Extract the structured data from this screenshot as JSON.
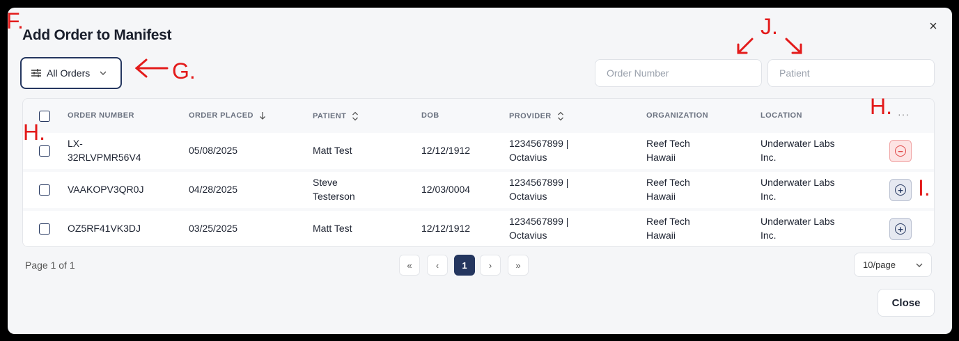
{
  "modal": {
    "title": "Add Order to Manifest",
    "close_icon": "×"
  },
  "filter": {
    "label": "All Orders"
  },
  "search": {
    "order_placeholder": "Order Number",
    "patient_placeholder": "Patient"
  },
  "table": {
    "headers": {
      "order_number": "ORDER NUMBER",
      "order_placed": "ORDER PLACED",
      "patient": "PATIENT",
      "dob": "DOB",
      "provider": "PROVIDER",
      "organization": "ORGANIZATION",
      "location": "LOCATION",
      "more": "···"
    },
    "rows": [
      {
        "order_number_1": "LX-",
        "order_number_2": "32RLVPMR56V4",
        "order_placed": "05/08/2025",
        "patient_1": "Matt Test",
        "patient_2": "",
        "dob": "12/12/1912",
        "provider_1": "1234567899 |",
        "provider_2": "Octavius",
        "organization_1": "Reef Tech",
        "organization_2": "Hawaii",
        "location_1": "Underwater Labs",
        "location_2": "Inc.",
        "action_icon": "−"
      },
      {
        "order_number_1": "VAAKOPV3QR0J",
        "order_number_2": "",
        "order_placed": "04/28/2025",
        "patient_1": "Steve",
        "patient_2": "Testerson",
        "dob": "12/03/0004",
        "provider_1": "1234567899 |",
        "provider_2": "Octavius",
        "organization_1": "Reef Tech",
        "organization_2": "Hawaii",
        "location_1": "Underwater Labs",
        "location_2": "Inc.",
        "action_icon": "+"
      },
      {
        "order_number_1": "OZ5RF41VK3DJ",
        "order_number_2": "",
        "order_placed": "03/25/2025",
        "patient_1": "Matt Test",
        "patient_2": "",
        "dob": "12/12/1912",
        "provider_1": "1234567899 |",
        "provider_2": "Octavius",
        "organization_1": "Reef Tech",
        "organization_2": "Hawaii",
        "location_1": "Underwater Labs",
        "location_2": "Inc.",
        "action_icon": "+"
      }
    ]
  },
  "pagination": {
    "info": "Page 1 of 1",
    "first": "«",
    "prev": "‹",
    "current": "1",
    "next": "›",
    "last": "»",
    "per_page": "10/page"
  },
  "footer": {
    "close_label": "Close"
  },
  "annotations": {
    "f": "F.",
    "g": "G.",
    "h_header": "H.",
    "h_row": "H.",
    "i": "I.",
    "j": "J."
  },
  "colors": {
    "primary": "#24365f",
    "danger": "#e04545",
    "annotation": "#e31b1b"
  }
}
